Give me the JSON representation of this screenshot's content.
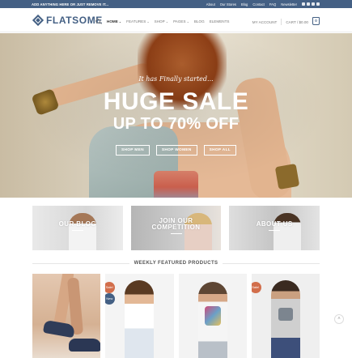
{
  "colors": {
    "primary": "#446084",
    "sale": "#d26e4b",
    "new": "#446084"
  },
  "topbar": {
    "announcement": "ADD ANYTHING HERE OR JUST REMOVE IT...",
    "links": [
      "About",
      "Our Stores",
      "Blog",
      "Contact",
      "FAQ"
    ],
    "newsletter": "Newsletter",
    "social_icons": [
      "facebook-icon",
      "instagram-icon",
      "twitter-icon",
      "email-icon"
    ]
  },
  "header": {
    "logo_text": "FLATSOME",
    "nav": [
      {
        "label": "HOME",
        "dropdown": true,
        "active": true
      },
      {
        "label": "FEATURES",
        "dropdown": true,
        "active": false
      },
      {
        "label": "SHOP",
        "dropdown": true,
        "active": false
      },
      {
        "label": "PAGES",
        "dropdown": true,
        "active": false
      },
      {
        "label": "BLOG",
        "dropdown": false,
        "active": false
      },
      {
        "label": "ELEMENTS",
        "dropdown": false,
        "active": false
      }
    ],
    "account": "MY ACCOUNT",
    "cart": "CART / $0.00",
    "cart_count": "0"
  },
  "hero": {
    "tagline": "It has Finally started...",
    "headline": "HUGE SALE",
    "subheadline": "UP TO 70% OFF",
    "buttons": [
      "SHOP MEN",
      "SHOP WOMEN",
      "SHOP ALL"
    ]
  },
  "banners": [
    {
      "label": "OUR BLOG"
    },
    {
      "label_line1": "JOIN OUR",
      "label_line2": "COMPETITION"
    },
    {
      "label": "ABOUT US"
    }
  ],
  "featured": {
    "title": "WEEKLY FEATURED PRODUCTS",
    "badges": {
      "sale": "Sale!",
      "new": "New"
    }
  },
  "fab_icon": "chevron-up-icon"
}
